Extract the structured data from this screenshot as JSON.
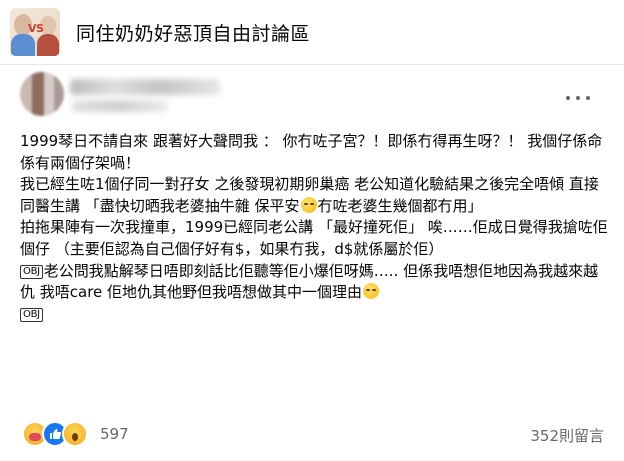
{
  "group": {
    "title": "同住奶奶好惡頂自由討論區",
    "avatar_text": "VS"
  },
  "post": {
    "paragraphs": [
      "1999琴日不請自來 跟著好大聲問我 ： 你冇咗子宮？！即係冇得再生呀？！ 我個仔係命係有兩個仔架喎！",
      "我已經生咗1個仔同一對孖女 之後發現初期卵巢癌 老公知道化驗結果之後完全唔傾 直接同醫生講 「盡快切晒我老婆抽牛雜 保平安",
      "冇咗老婆生幾個都冇用」",
      "拍拖果陣有一次我撞車，1999已經同老公講 「最好撞死佢」 唉……佢成日覺得我搶咗佢個仔 （主要佢認為自己個仔好有$，如果冇我，d$就係屬於佢）",
      "老公問我點解琴日唔即刻話比佢聽等佢小爆佢呀媽….. 但係我唔想佢地因為我越來越仇 我唔care 佢地仇其他野但我唔想做其中一個理由"
    ],
    "icon_label": "OBJ",
    "emojis": [
      "grinning-sweat-emoji",
      "downcast-sweat-emoji"
    ]
  },
  "footer": {
    "reaction_icons": [
      "care-icon",
      "like-icon",
      "wow-icon"
    ],
    "reaction_count": "597",
    "comment_count": "352則留言"
  }
}
